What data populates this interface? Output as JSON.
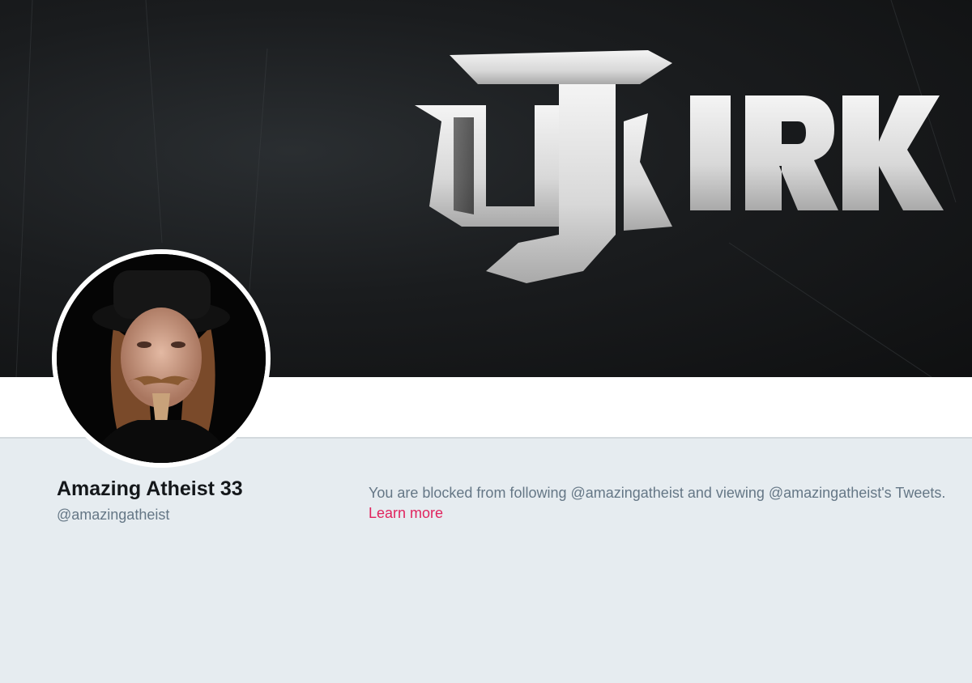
{
  "banner": {
    "logo_text": "UJKIRK"
  },
  "profile": {
    "name": "Amazing Atheist 33",
    "handle": "@amazingatheist"
  },
  "blocked": {
    "message": "You are blocked from following @amazingatheist and viewing @amazingatheist's Tweets.",
    "learn_more": "Learn more"
  },
  "colors": {
    "link": "#e0245e",
    "muted_text": "#657786",
    "name_text": "#14171a",
    "page_bg": "#e6ecf0"
  }
}
